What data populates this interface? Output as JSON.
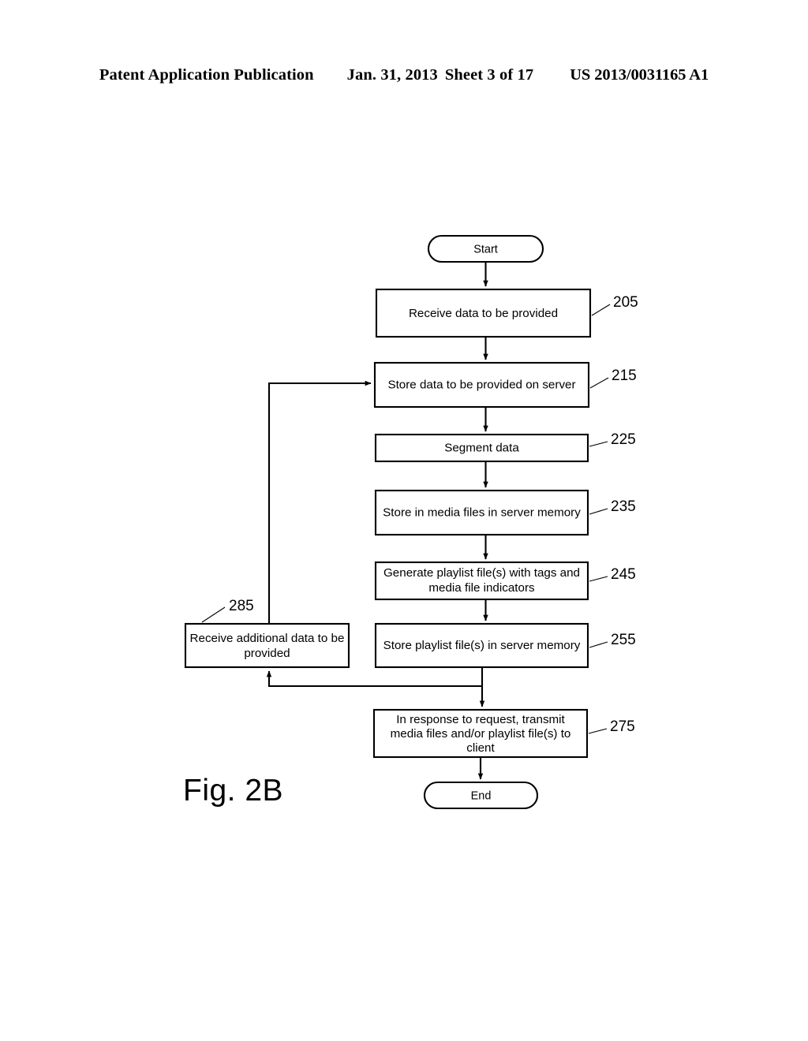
{
  "header": {
    "publication": "Patent Application Publication",
    "date": "Jan. 31, 2013",
    "sheet": "Sheet 3 of 17",
    "document_number": "US 2013/0031165 A1"
  },
  "figure": {
    "label": "Fig. 2B"
  },
  "flowchart": {
    "start_node": {
      "label": "Start"
    },
    "end_node": {
      "label": "End"
    },
    "steps": [
      {
        "ref": "205",
        "label": "Receive data to be provided",
        "lines": [
          "Receive data to be provided"
        ]
      },
      {
        "ref": "215",
        "label": "Store data to be provided on server",
        "lines": [
          "Store data to be provided on server"
        ]
      },
      {
        "ref": "225",
        "label": "Segment data",
        "lines": [
          "Segment data"
        ]
      },
      {
        "ref": "235",
        "label": "Store in media files in server memory",
        "lines": [
          "Store in media files in server memory"
        ]
      },
      {
        "ref": "245",
        "label": "Generate playlist file(s) with tags and media file indicators",
        "lines": [
          "Generate playlist file(s) with tags and",
          "media file indicators"
        ]
      },
      {
        "ref": "255",
        "label": "Store playlist file(s) in server memory",
        "lines": [
          "Store playlist file(s) in server memory"
        ]
      },
      {
        "ref": "275",
        "label": "In response to request, transmit media files and/or playlist file(s) to client",
        "lines": [
          "In response to request, transmit",
          "media files and/or playlist file(s) to",
          "client"
        ]
      },
      {
        "ref": "285",
        "label": "Receive additional data to be provided",
        "lines": [
          "Receive additional data to be",
          "provided"
        ]
      }
    ]
  },
  "colors": {
    "ink": "#000000",
    "paper": "#ffffff"
  }
}
